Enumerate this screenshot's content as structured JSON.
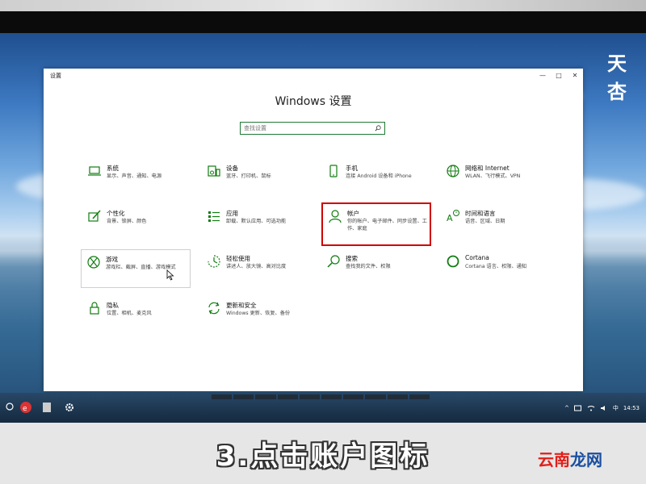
{
  "window": {
    "title": "设置",
    "heading": "Windows 设置",
    "search_placeholder": "查找设置",
    "controls": {
      "minimize": "—",
      "maximize": "□",
      "close": "✕"
    }
  },
  "tiles": [
    {
      "name": "系统",
      "desc": "显示、声音、通知、电源",
      "icon": "laptop-icon"
    },
    {
      "name": "设备",
      "desc": "蓝牙、打印机、鼠标",
      "icon": "devices-icon"
    },
    {
      "name": "手机",
      "desc": "连接 Android 设备和 iPhone",
      "icon": "phone-icon"
    },
    {
      "name": "网络和 Internet",
      "desc": "WLAN、飞行模式、VPN",
      "icon": "globe-icon"
    },
    {
      "name": "个性化",
      "desc": "背景、锁屏、颜色",
      "icon": "personalize-icon"
    },
    {
      "name": "应用",
      "desc": "卸载、默认应用、可选功能",
      "icon": "apps-list-icon"
    },
    {
      "name": "帐户",
      "desc": "你的帐户、电子邮件、同步设置、工作、家庭",
      "icon": "person-icon"
    },
    {
      "name": "时间和语言",
      "desc": "语音、区域、日期",
      "icon": "time-language-icon"
    },
    {
      "name": "游戏",
      "desc": "游戏栏、截屏、直播、游戏模式",
      "icon": "xbox-icon"
    },
    {
      "name": "轻松使用",
      "desc": "讲述人、放大镜、高对比度",
      "icon": "ease-of-access-icon"
    },
    {
      "name": "搜索",
      "desc": "查找我的文件、权限",
      "icon": "search-icon"
    },
    {
      "name": "Cortana",
      "desc": "Cortana 语言、权限、通知",
      "icon": "cortana-icon"
    },
    {
      "name": "隐私",
      "desc": "位置、相机、麦克风",
      "icon": "lock-icon"
    },
    {
      "name": "更新和安全",
      "desc": "Windows 更新、恢复、备份",
      "icon": "update-icon"
    }
  ],
  "taskbar": {
    "clock": "14:53",
    "ime": "中"
  },
  "caption": {
    "text": "3.点击账户图标",
    "brand_part1": "云南",
    "brand_part2": "龙网",
    "corner_logo": "天杏"
  },
  "colors": {
    "accent": "#107c10",
    "highlight": "#d00000",
    "brand_red": "#e0201a",
    "brand_blue": "#1a4fa0"
  }
}
